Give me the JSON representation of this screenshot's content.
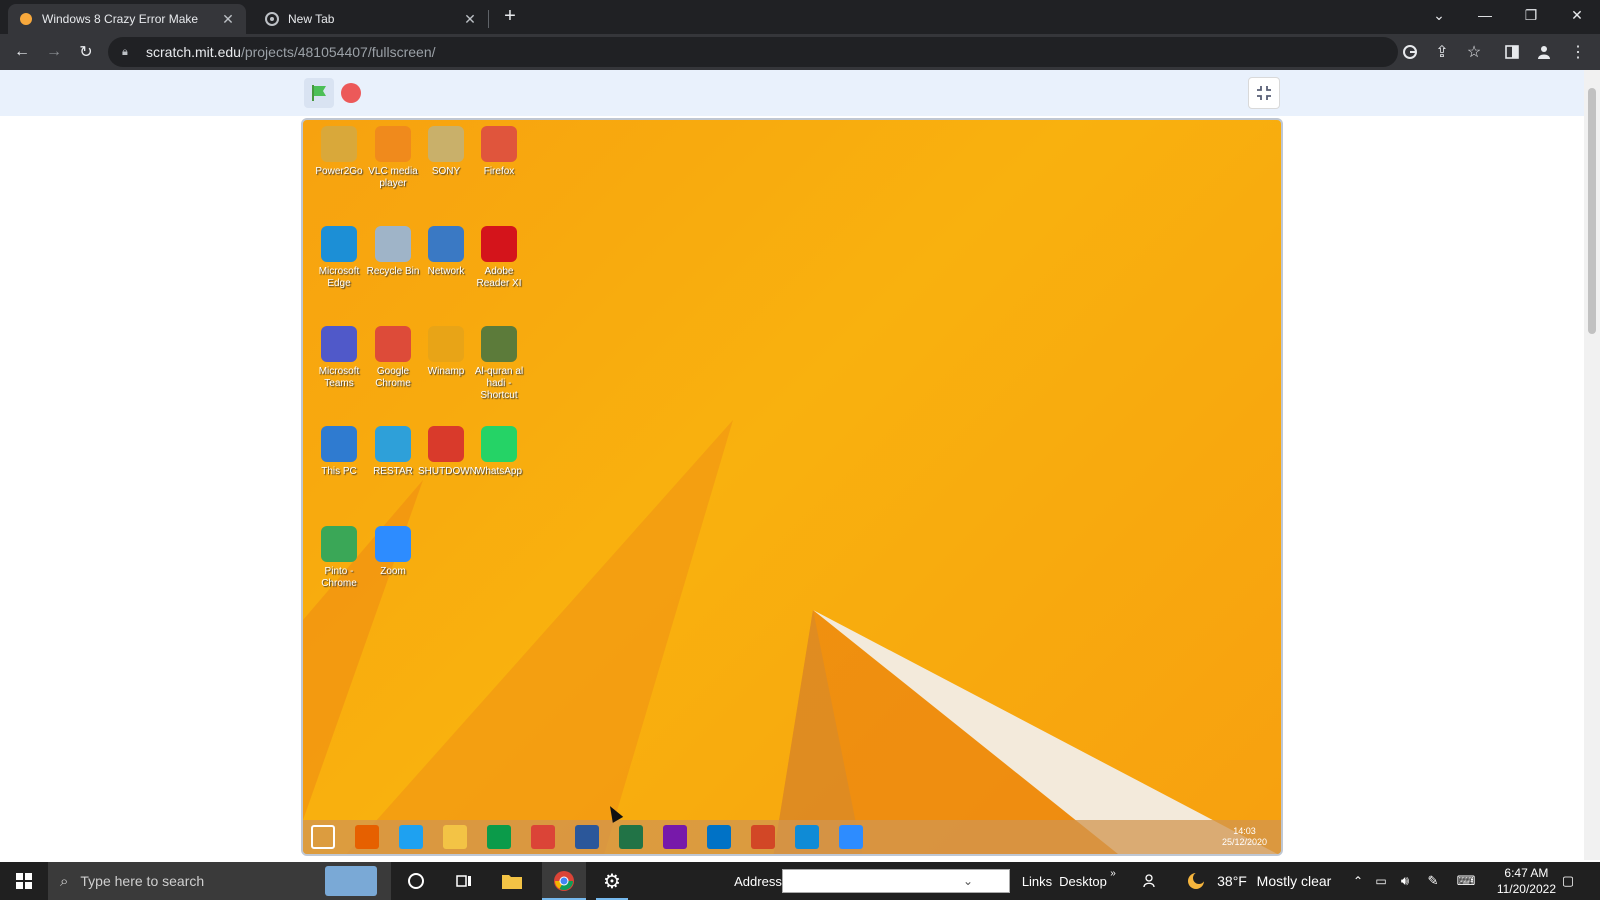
{
  "browser": {
    "tabs": [
      {
        "title": "Windows 8 Crazy Error Make",
        "active": true
      },
      {
        "title": "New Tab",
        "active": false
      }
    ],
    "url_host": "scratch.mit.edu",
    "url_path": "/projects/481054407/fullscreen/"
  },
  "desktop": {
    "icons": [
      {
        "label": "Power2Go",
        "color": "#d9a83a"
      },
      {
        "label": "VLC media player",
        "color": "#f08a1c"
      },
      {
        "label": "SONY",
        "color": "#c9b06a"
      },
      {
        "label": "Firefox",
        "color": "#e0553c"
      },
      {
        "label": "Microsoft Edge",
        "color": "#1c8fd6"
      },
      {
        "label": "Recycle Bin",
        "color": "#9fb4c8"
      },
      {
        "label": "Network",
        "color": "#3a79c4"
      },
      {
        "label": "Adobe Reader XI",
        "color": "#d4141b"
      },
      {
        "label": "Microsoft Teams",
        "color": "#5059c9"
      },
      {
        "label": "Google Chrome",
        "color": "#dd4b39"
      },
      {
        "label": "Winamp",
        "color": "#e8a417"
      },
      {
        "label": "Al-quran al hadi - Shortcut",
        "color": "#5c7b3a"
      },
      {
        "label": "This PC",
        "color": "#2f7bd0"
      },
      {
        "label": "RESTAR",
        "color": "#2ea0d9"
      },
      {
        "label": "SHUTDOWN",
        "color": "#d93a2b"
      },
      {
        "label": "WhatsApp",
        "color": "#25d366"
      },
      {
        "label": "Pinto - Chrome",
        "color": "#3aa757"
      },
      {
        "label": "Zoom",
        "color": "#2d8cff"
      }
    ],
    "taskbar_icons": [
      "windows-logo",
      "firefox",
      "internet-explorer",
      "file-explorer",
      "store",
      "chrome",
      "word",
      "excel",
      "onenote",
      "outlook",
      "powerpoint",
      "edge",
      "zoom"
    ],
    "tray_time": "14:03",
    "tray_date": "25/12/2020"
  },
  "taskbar": {
    "search_placeholder": "Type here to search",
    "address_label": "Address",
    "links_label": "Links",
    "desktop_label": "Desktop",
    "weather_temp": "38°F",
    "weather_text": "Mostly clear",
    "time": "6:47 AM",
    "date": "11/20/2022"
  }
}
